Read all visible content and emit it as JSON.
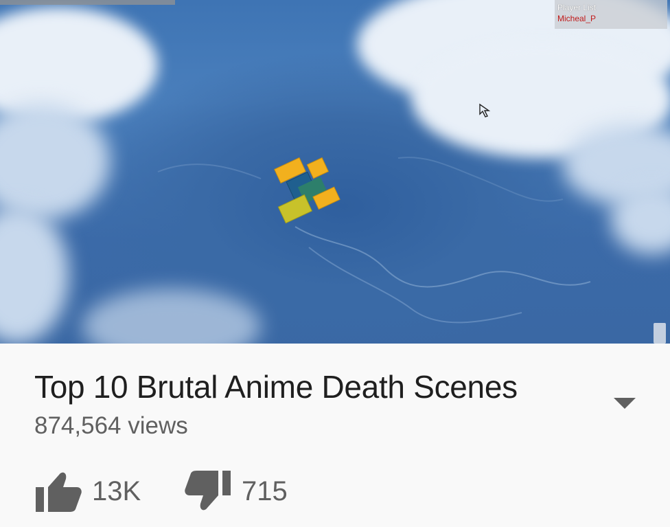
{
  "video": {
    "scene": "roblox-skydive-gameplay",
    "player_list": {
      "title": "Player List",
      "players": [
        "Micheal_P"
      ]
    },
    "colors": {
      "sky_blue": "#3e74b4",
      "cloud": "#e9f0f8",
      "player_name": "#c01818"
    }
  },
  "meta": {
    "title": "Top 10 Brutal Anime Death Scenes",
    "views": "874,564 views",
    "expand_icon": "caret-down-icon"
  },
  "actions": {
    "like": {
      "icon": "thumbs-up-icon",
      "count": "13K"
    },
    "dislike": {
      "icon": "thumbs-down-icon",
      "count": "715"
    }
  }
}
